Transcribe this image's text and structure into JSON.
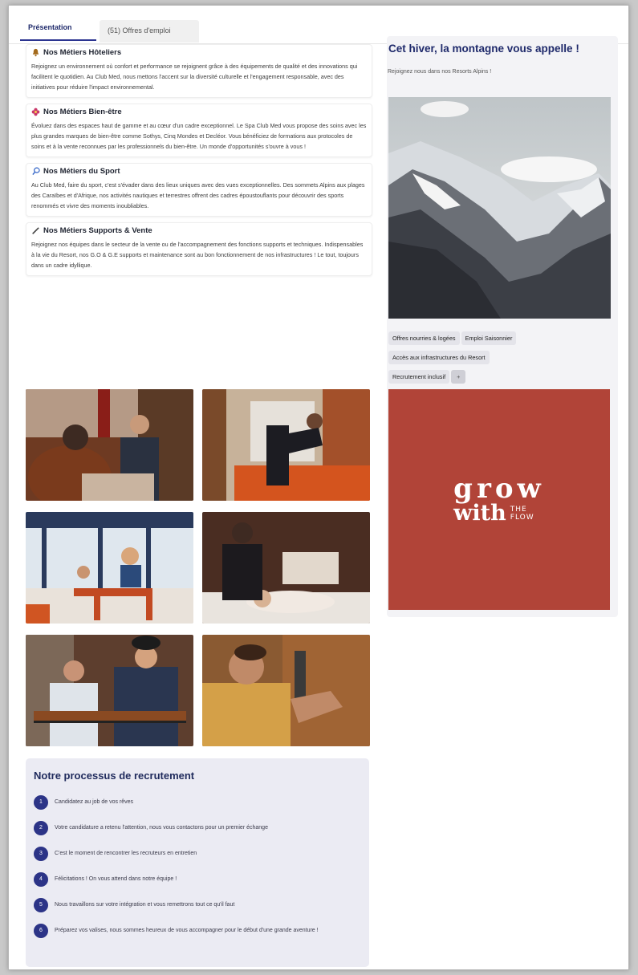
{
  "tabs": [
    {
      "label": "Présentation",
      "active": true
    },
    {
      "label": "(51) Offres d'emploi",
      "active": false
    }
  ],
  "sections": [
    {
      "title": "Nos Métiers Hôteliers",
      "icon": "bell-icon",
      "text": "Rejoignez un environnement où confort et performance se rejoignent grâce à des équipements de qualité et des innovations qui facilitent le quotidien. Au Club Med, nous mettons l'accent sur la diversité culturelle et l'engagement responsable, avec des initiatives pour réduire l'impact environnemental."
    },
    {
      "title": "Nos Métiers Bien-être",
      "icon": "flower-icon",
      "text": "Évoluez dans des espaces haut de gamme et au cœur d'un cadre exceptionnel. Le Spa Club Med vous propose des soins avec les plus grandes marques de bien-être comme Sothys, Cinq Mondes et Decléor. Vous bénéficiez de formations aux protocoles de soins et à la vente reconnues par les professionnels du bien-être. Un monde d'opportunités s'ouvre à vous !"
    },
    {
      "title": "Nos Métiers du Sport",
      "icon": "racket-icon",
      "text": "Au Club Med, faire du sport, c'est s'évader dans des lieux uniques avec des vues exceptionnelles. Des sommets Alpins aux plages des Caraïbes et d'Afrique, nos activités nautiques et terrestres offrent des cadres époustouflants pour découvrir des sports renommés et vivre des moments inoubliables."
    },
    {
      "title": "Nos Métiers Supports & Vente",
      "icon": "pen-icon",
      "text": "Rejoignez nos équipes dans le secteur de la vente ou de l'accompagnement des fonctions supports et techniques. Indispensables à la vie du Resort, nos G.O & G.E supports et maintenance sont au bon fonctionnement de nos infrastructures ! Le tout, toujours dans un cadre idyllique."
    }
  ],
  "process": {
    "title": "Notre processus de recrutement",
    "steps": [
      {
        "num": "1",
        "text": "Candidatez au job de vos rêves"
      },
      {
        "num": "2",
        "text": "Votre candidature a retenu l'attention, nous vous contactons pour un premier échange"
      },
      {
        "num": "3",
        "text": "C'est le moment de rencontrer les recruteurs en entretien"
      },
      {
        "num": "4",
        "text": "Félicitations ! On vous attend dans notre équipe !"
      },
      {
        "num": "5",
        "text": "Nous travaillons sur votre intégration et vous remettrons tout ce qu'il faut"
      },
      {
        "num": "6",
        "text": "Préparez vos valises, nous sommes heureux de vous accompagner pour le début d'une grande aventure !"
      }
    ]
  },
  "aside": {
    "title": "Cet hiver, la montagne vous appelle !",
    "subtitle": "Rejoignez nous dans nos Resorts Alpins !",
    "tags": [
      "Offres nourries & logées",
      "Emploi Saisonnier",
      "Accès aux infrastructures du Resort",
      "Recrutement inclusif",
      "+"
    ],
    "logo": {
      "line1": "grow",
      "line2": "with",
      "the": "THE",
      "flow": "FLOW"
    }
  },
  "colors": {
    "accent": "#2c3487",
    "title": "#1f2a6b",
    "logo_bg": "#b14438"
  }
}
